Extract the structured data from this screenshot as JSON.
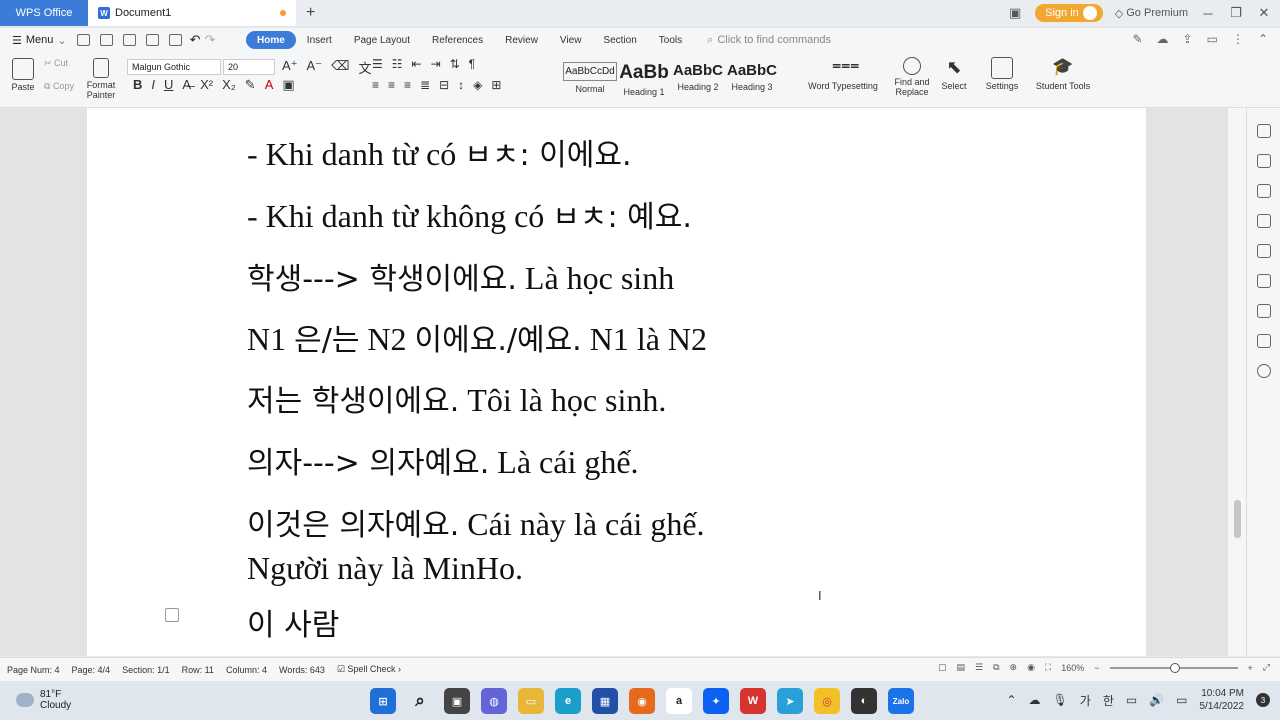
{
  "titlebar": {
    "app_tab": "WPS Office",
    "doc_tab": "Document1",
    "new_tab": "+",
    "sign_in": "Sign in",
    "premium": "Go Premium"
  },
  "menu": {
    "menu_label": "Menu",
    "tabs": [
      "Home",
      "Insert",
      "Page Layout",
      "References",
      "Review",
      "View",
      "Section",
      "Tools"
    ],
    "search_placeholder": "Click to find commands"
  },
  "ribbon": {
    "paste": "Paste",
    "cut": "Cut",
    "copy": "Copy",
    "format_painter_1": "Format",
    "format_painter_2": "Painter",
    "font_name": "Malgun Gothic",
    "font_size": "20",
    "styles": [
      {
        "sample": "AaBbCcDd",
        "label": "Normal"
      },
      {
        "sample": "AaBb",
        "label": "Heading 1"
      },
      {
        "sample": "AaBbC",
        "label": "Heading 2"
      },
      {
        "sample": "AaBbC",
        "label": "Heading 3"
      }
    ],
    "word_typesetting": "Word Typesetting",
    "find_replace_1": "Find and",
    "find_replace_2": "Replace",
    "select": "Select",
    "settings": "Settings",
    "student_tools": "Student Tools"
  },
  "document": {
    "line1_a": "- Khi danh từ  có  ",
    "line1_b": "ㅂㅊ:  이에요.",
    "line2_a": "- Khi danh từ  không có  ",
    "line2_b": "ㅂㅊ:  예요.",
    "line3_a": "학생--->  학생이에요.",
    "line3_b": " Là học sinh",
    "line4_a": "N1 ",
    "line4_b": "은/는",
    "line4_c": "  N2 ",
    "line4_d": "이에요./예요.",
    "line4_e": " N1 là N2",
    "line5_a": "저는  학생이에요.",
    "line5_b": " Tôi là học sinh.",
    "line6_a": "의자--->  의자예요.",
    "line6_b": " Là cái ghế.",
    "line7_a": "이것은  의자예요.",
    "line7_b": " Cái này là cái ghế.",
    "line8": "Người này là MinHo.",
    "line9": "이  사람"
  },
  "status": {
    "page_num": "Page Num: 4",
    "page": "Page: 4/4",
    "section": "Section: 1/1",
    "row": "Row: 11",
    "column": "Column: 4",
    "words": "Words: 643",
    "spell_check": "Spell Check",
    "zoom": "160%"
  },
  "taskbar": {
    "temp": "81°F",
    "weather": "Cloudy",
    "ime1": "가",
    "ime2": "한",
    "time": "10:04 PM",
    "date": "5/14/2022",
    "notifications": "3"
  }
}
